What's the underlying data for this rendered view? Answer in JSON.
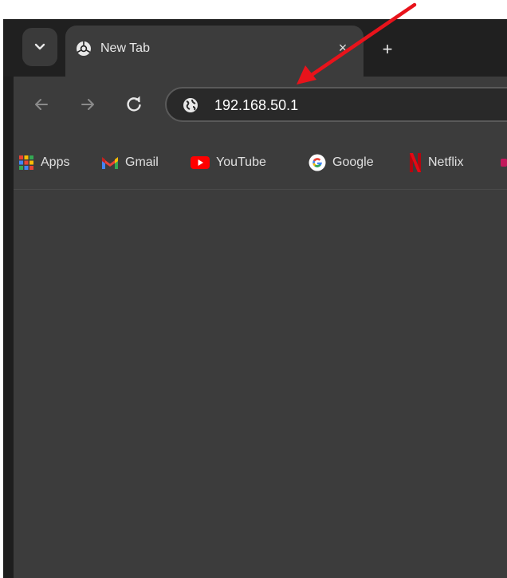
{
  "browser": {
    "tab_search_icon": "chevron-down-icon",
    "tab": {
      "title": "New Tab",
      "favicon": "chrome-icon",
      "close_label": "×"
    },
    "new_tab_label": "+",
    "toolbar": {
      "back_icon": "back-arrow-icon",
      "forward_icon": "forward-arrow-icon",
      "reload_icon": "reload-icon",
      "address_icon": "globe-icon",
      "address_value": "192.168.50.1"
    },
    "bookmarks": [
      {
        "label": "Apps",
        "icon": "apps-grid-icon"
      },
      {
        "label": "Gmail",
        "icon": "gmail-icon"
      },
      {
        "label": "YouTube",
        "icon": "youtube-icon"
      },
      {
        "label": "Google",
        "icon": "google-icon"
      },
      {
        "label": "Netflix",
        "icon": "netflix-icon"
      }
    ]
  },
  "annotation": {
    "type": "red-arrow",
    "color": "#e8131b",
    "points_to": "address-bar"
  },
  "colors": {
    "titlebar": "#202020",
    "tab_active": "#3c3c3c",
    "omnibox": "#292929",
    "text": "#e8e8e8"
  }
}
